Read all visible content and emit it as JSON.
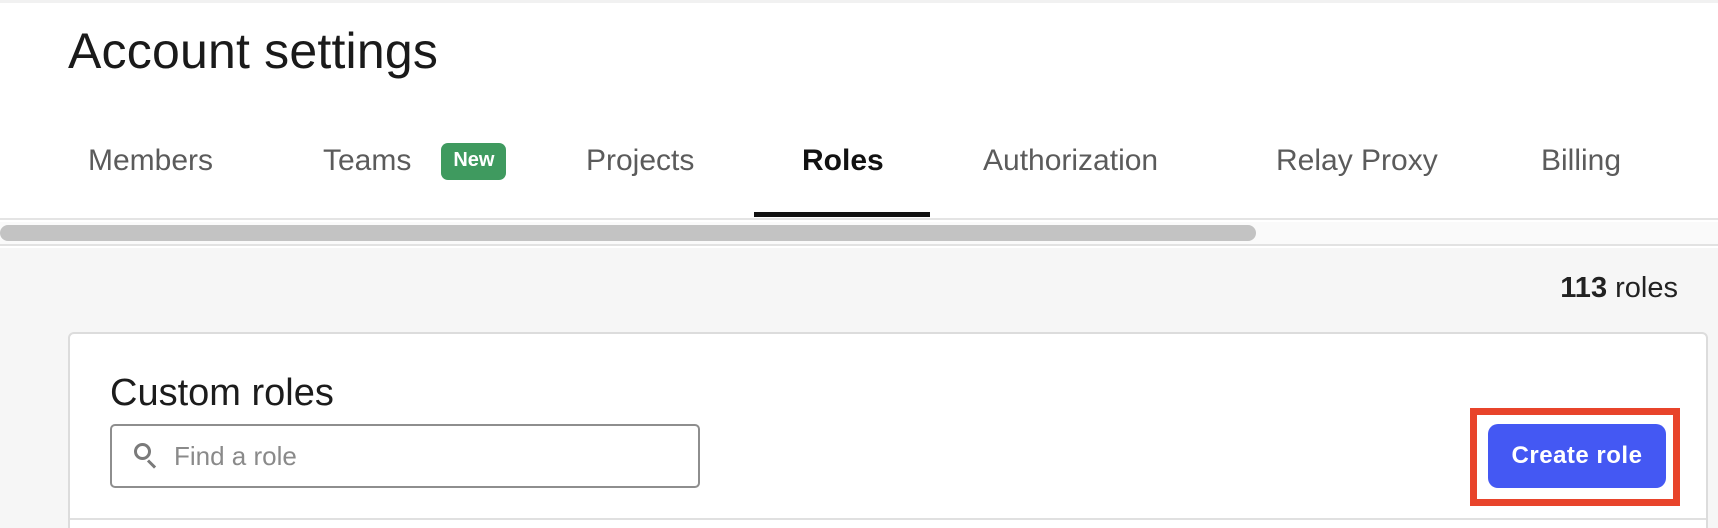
{
  "header": {
    "title": "Account settings"
  },
  "tabs": [
    {
      "label": "Members",
      "active": false
    },
    {
      "label": "Teams",
      "active": false,
      "badge": "New"
    },
    {
      "label": "Projects",
      "active": false
    },
    {
      "label": "Roles",
      "active": true
    },
    {
      "label": "Authorization",
      "active": false
    },
    {
      "label": "Relay Proxy",
      "active": false
    },
    {
      "label": "Billing",
      "active": false
    }
  ],
  "summary": {
    "count": "113",
    "unit": "roles"
  },
  "custom_roles": {
    "title": "Custom roles",
    "search": {
      "placeholder": "Find a role",
      "value": "",
      "icon": "search-icon"
    },
    "create_button_label": "Create role"
  },
  "colors": {
    "accent": "#4458f3",
    "badge_new": "#3f9a5f",
    "highlight": "#e8442b"
  }
}
